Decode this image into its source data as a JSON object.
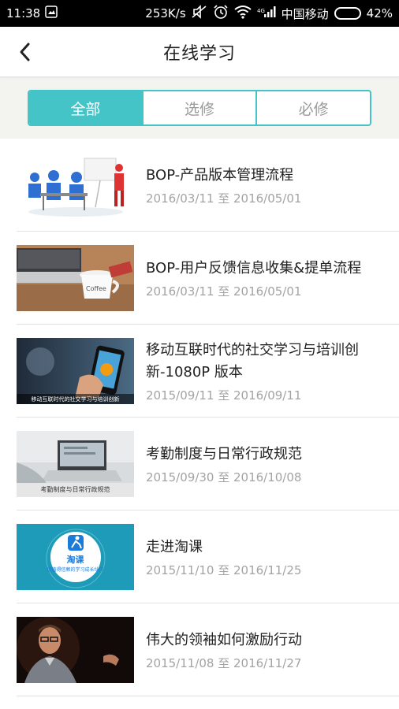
{
  "status_bar": {
    "time": "11:38",
    "net_speed": "253K/s",
    "carrier": "中国移动",
    "battery": "42%",
    "battery_level": 0.42
  },
  "header": {
    "title": "在线学习",
    "back_icon": "chevron-left-icon"
  },
  "tabs": [
    {
      "label": "全部",
      "active": true
    },
    {
      "label": "选修",
      "active": false
    },
    {
      "label": "必修",
      "active": false
    }
  ],
  "colors": {
    "accent": "#45c4c8",
    "title_text": "#222222",
    "date_text": "#a3a3a3"
  },
  "courses": [
    {
      "title": "BOP-产品版本管理流程",
      "date": "2016/03/11 至 2016/05/01",
      "thumb_caption": ""
    },
    {
      "title": "BOP-用户反馈信息收集&提单流程",
      "date": "2016/03/11 至 2016/05/01",
      "thumb_caption": ""
    },
    {
      "title": "移动互联时代的社交学习与培训创新-1080P 版本",
      "date": "2015/09/11 至 2016/09/11",
      "thumb_caption": "移动互联时代的社交学习与培训创新"
    },
    {
      "title": "考勤制度与日常行政规范",
      "date": "2015/09/30 至 2016/10/08",
      "thumb_caption": "考勤制度与日常行政规范"
    },
    {
      "title": "走进淘课",
      "date": "2015/11/10 至 2016/11/25",
      "thumb_caption": "",
      "logo_text": "淘课",
      "logo_subtext": "您值得信赖的学习成长伙伴"
    },
    {
      "title": "伟大的领袖如何激励行动",
      "date": "2015/11/08 至 2016/11/27",
      "thumb_caption": ""
    }
  ]
}
